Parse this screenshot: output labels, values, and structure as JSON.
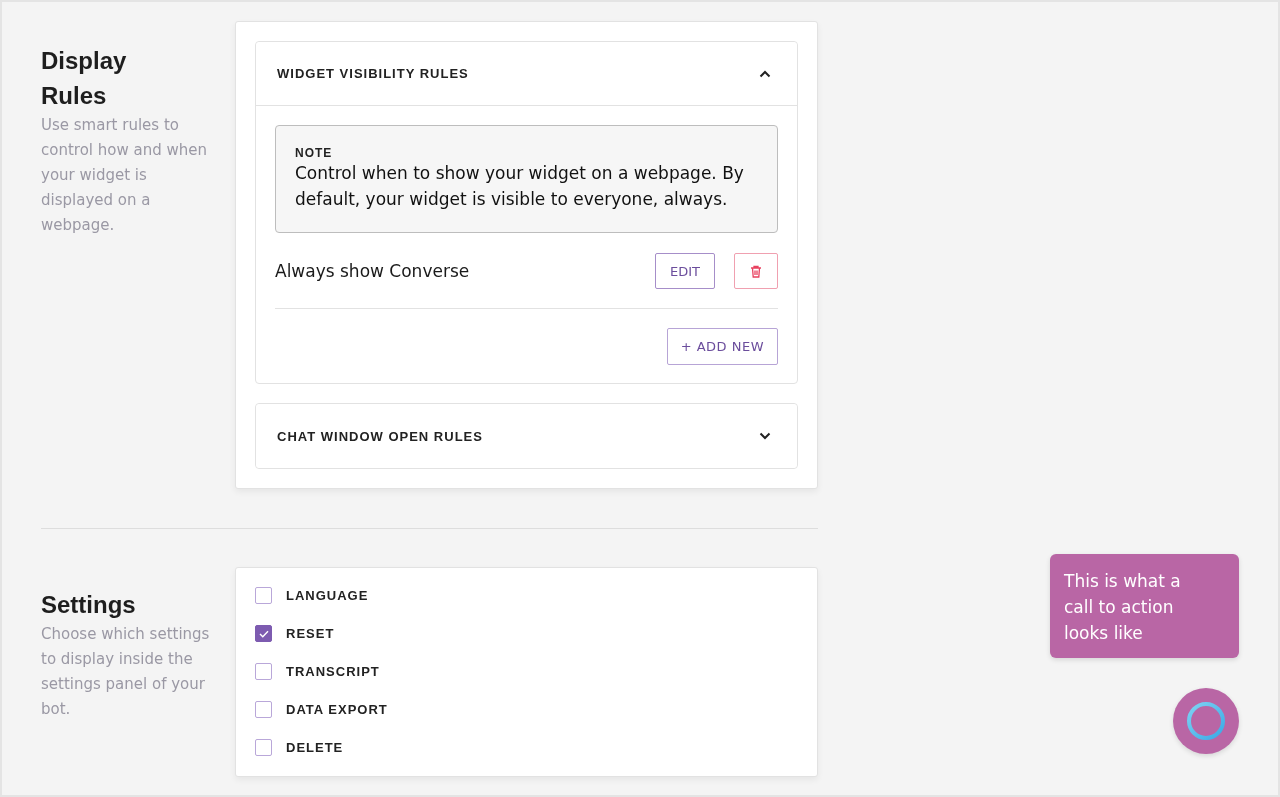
{
  "sections": [
    {
      "title": "Display Rules",
      "description": "Use smart rules to control how and when your widget is displayed on a webpage.",
      "kind": "rules"
    },
    {
      "title": "Settings",
      "description": "Choose which settings to display inside the settings panel of your bot.",
      "kind": "settings"
    }
  ],
  "accordions": [
    {
      "title": "WIDGET VISIBILITY RULES",
      "expanded": true,
      "note": {
        "label": "NOTE",
        "text": "Control when to show your widget on a webpage. By default, your widget is visible to everyone, always."
      },
      "rules": [
        {
          "name": "Always show Converse",
          "edit": "EDIT"
        }
      ],
      "add_button": "+ ADD NEW"
    },
    {
      "title": "CHAT WINDOW OPEN RULES",
      "expanded": false
    }
  ],
  "settings": [
    {
      "label": "LANGUAGE",
      "checked": false
    },
    {
      "label": "RESET",
      "checked": true
    },
    {
      "label": "TRANSCRIPT",
      "checked": false
    },
    {
      "label": "DATA EXPORT",
      "checked": false
    },
    {
      "label": "DELETE",
      "checked": false
    }
  ],
  "call_to_action": {
    "text": "This is what a call to action looks like"
  }
}
